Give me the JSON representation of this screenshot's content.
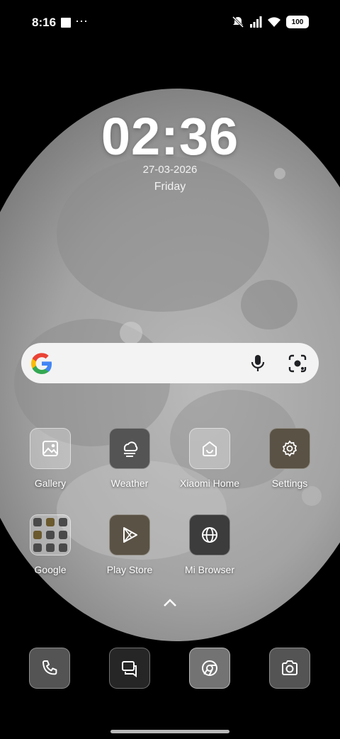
{
  "status_bar": {
    "time": "8:16",
    "more": "⋯",
    "battery": "100",
    "icons": [
      "mute-icon",
      "signal-icon",
      "wifi-icon",
      "battery-icon"
    ]
  },
  "lock": {
    "time": "02:36",
    "date": "27-03-2026",
    "day": "Friday"
  },
  "search": {
    "placeholder": "",
    "icons": [
      "google-logo",
      "mic-icon",
      "lens-icon"
    ]
  },
  "apps": [
    {
      "label": "Gallery",
      "icon": "gallery-icon"
    },
    {
      "label": "Weather",
      "icon": "weather-icon"
    },
    {
      "label": "Xiaomi Home",
      "icon": "xiaomi-home-icon"
    },
    {
      "label": "Settings",
      "icon": "gear-icon"
    },
    {
      "label": "Google",
      "icon": "folder-icon"
    },
    {
      "label": "Play Store",
      "icon": "play-store-icon"
    },
    {
      "label": "Mi Browser",
      "icon": "globe-icon"
    }
  ],
  "dock": [
    {
      "icon": "phone-icon"
    },
    {
      "icon": "messages-icon"
    },
    {
      "icon": "chrome-icon"
    },
    {
      "icon": "camera-icon"
    }
  ],
  "colors": {
    "tile_olive": "#5a5245",
    "tile_dark": "#545454",
    "search_bg": "#f3f3f3"
  }
}
